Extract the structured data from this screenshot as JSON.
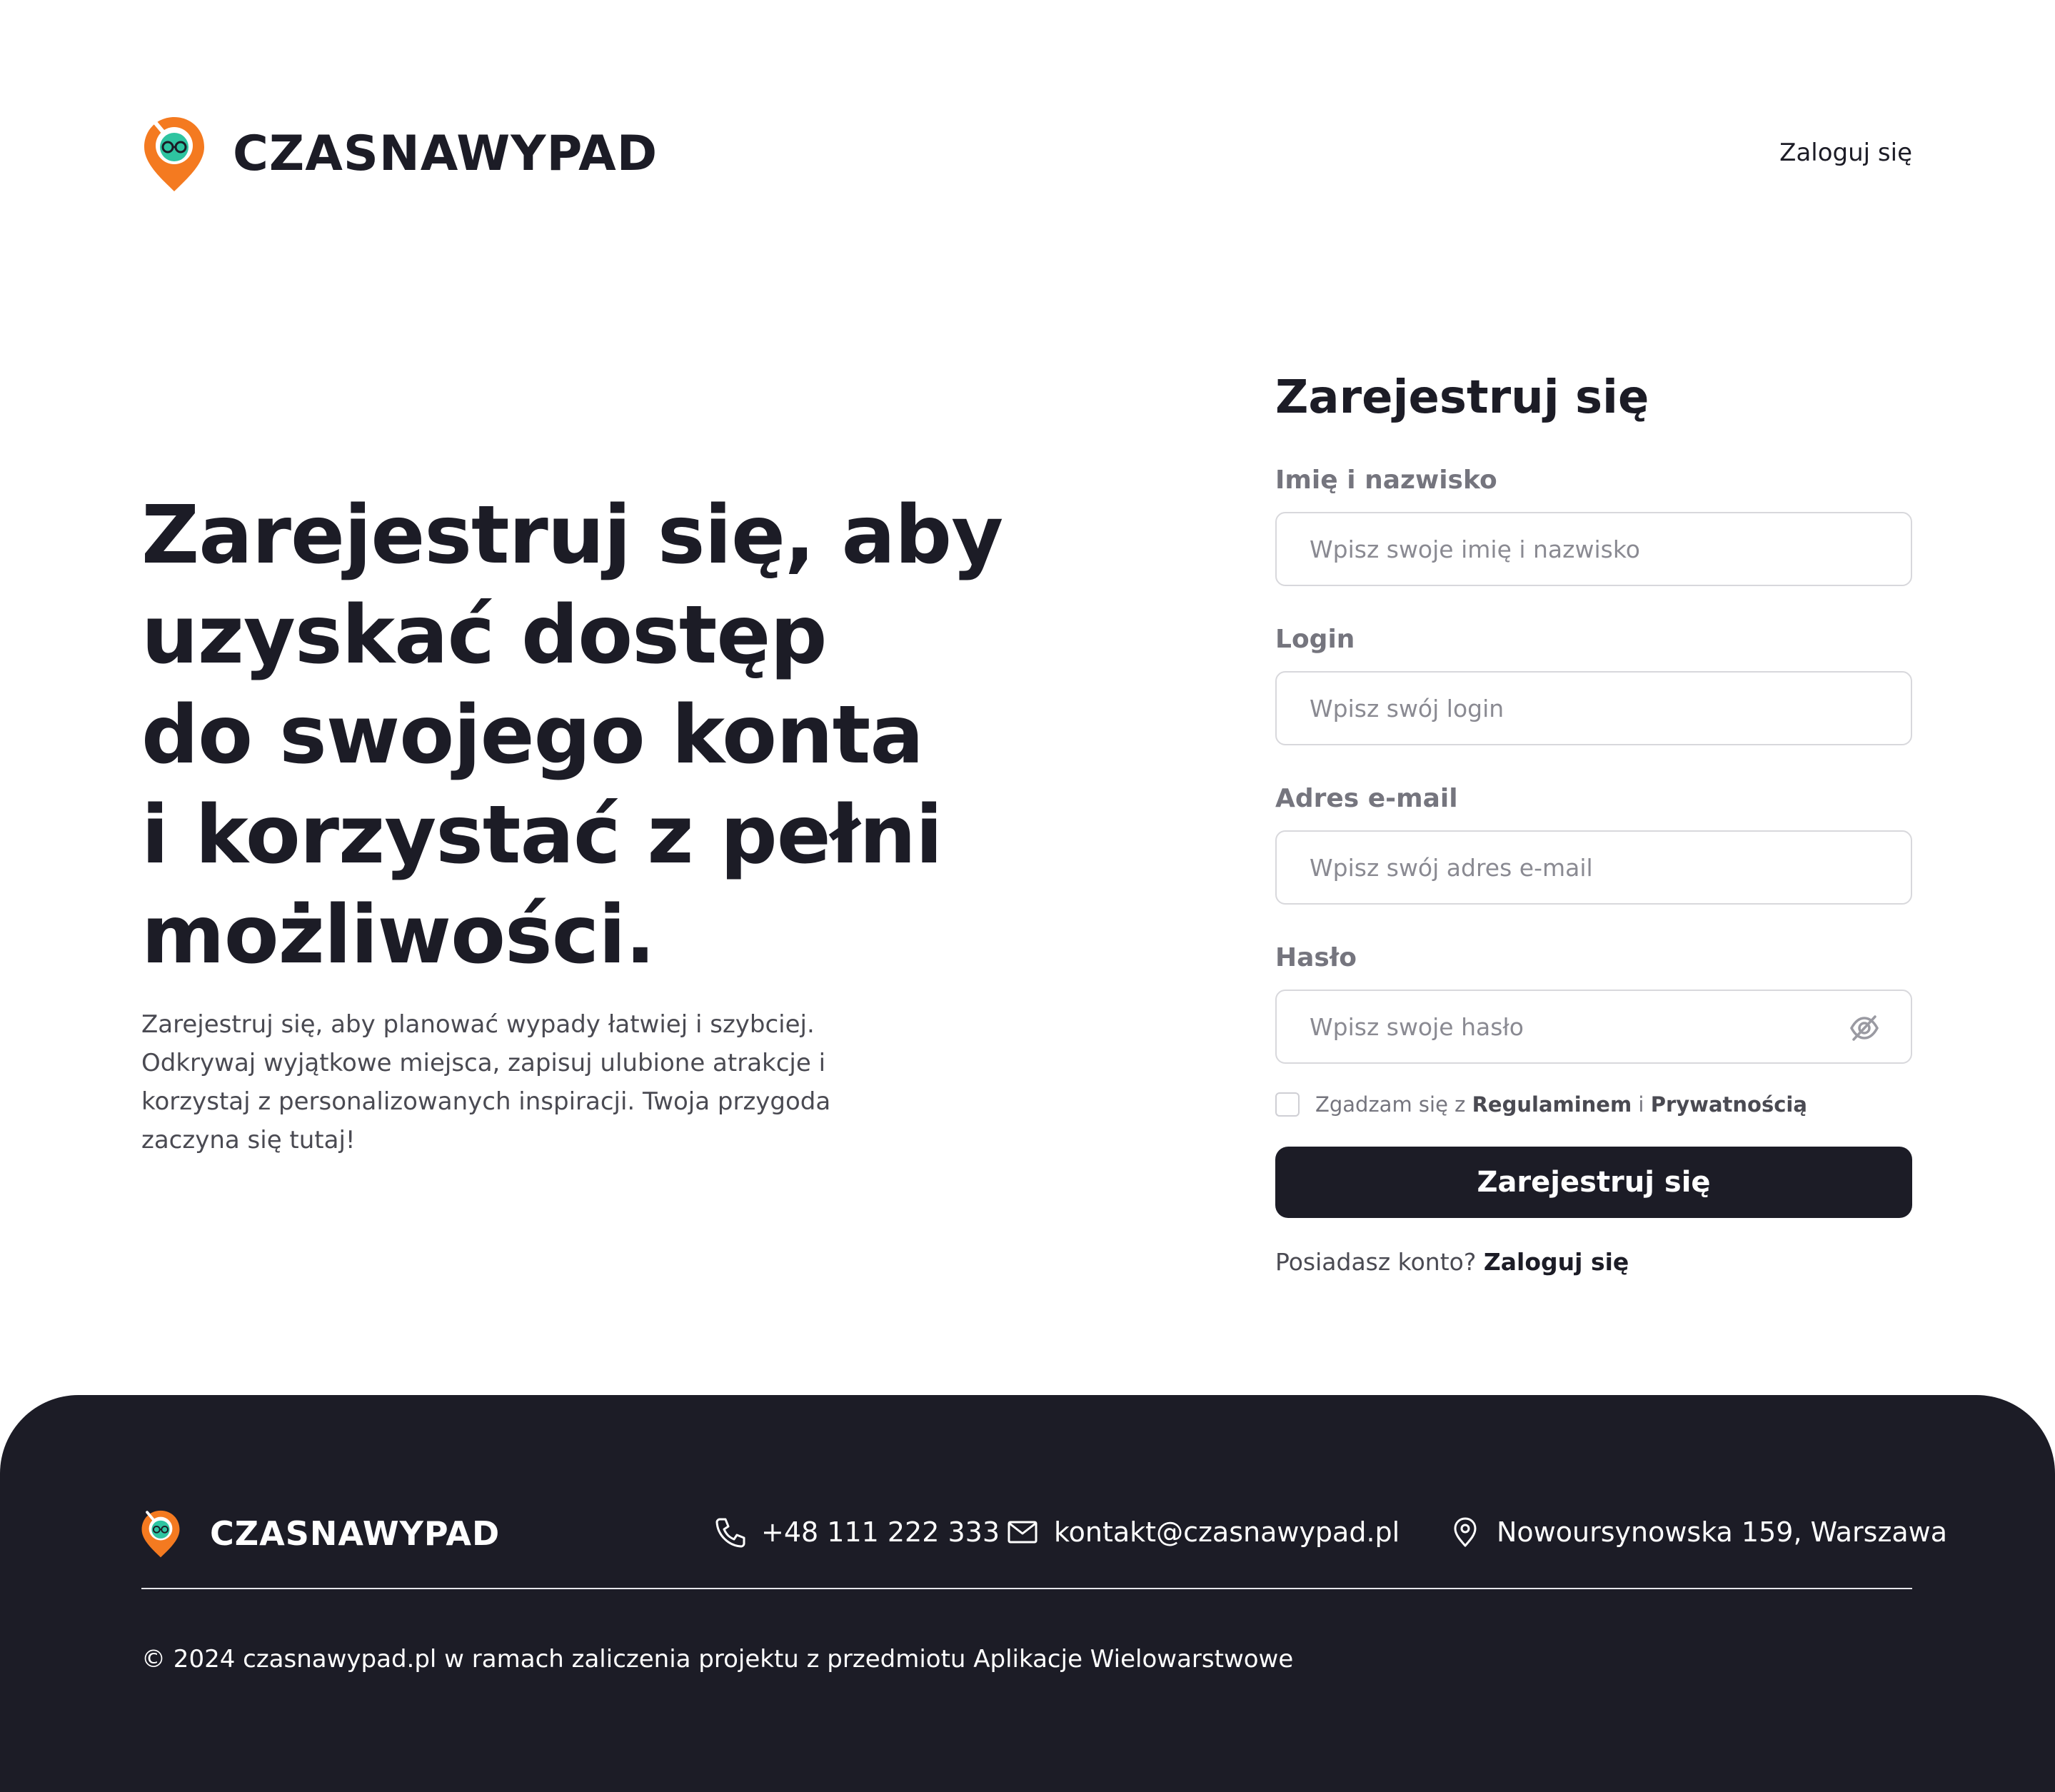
{
  "brand": {
    "name": "CZASNAWYPAD",
    "colors": {
      "pin_orange": "#F47A20",
      "pin_green": "#2EC4A0",
      "dark": "#1C1C26"
    }
  },
  "header": {
    "login_link": "Zaloguj się"
  },
  "hero": {
    "title_lines": [
      "Zarejestruj się, aby",
      "uzyskać dostęp",
      "do swojego konta",
      "i korzystać z pełni",
      "możliwości."
    ],
    "description": "Zarejestruj się, aby planować wypady łatwiej i szybciej. Odkrywaj wyjątkowe miejsca, zapisuj ulubione atrakcje i korzystaj z personalizowanych inspiracji. Twoja przygoda zaczyna się tutaj!"
  },
  "form": {
    "title": "Zarejestruj się",
    "fields": [
      {
        "label": "Imię i nazwisko",
        "placeholder": "Wpisz swoje imię i nazwisko",
        "value": ""
      },
      {
        "label": "Login",
        "placeholder": "Wpisz swój login",
        "value": ""
      },
      {
        "label": "Adres e-mail",
        "placeholder": "Wpisz swój adres e-mail",
        "value": ""
      },
      {
        "label": "Hasło",
        "placeholder": "Wpisz swoje hasło",
        "value": "",
        "icon": "eye-off-icon"
      }
    ],
    "agree": {
      "prefix": "Zgadzam się z",
      "terms": "Regulaminem",
      "and": "i",
      "privacy": "Prywatnością",
      "checked": false
    },
    "submit_label": "Zarejestruj się",
    "have_account_text": "Posiadasz konto?",
    "have_account_link": "Zaloguj się"
  },
  "footer": {
    "brand": "CZASNAWYPAD",
    "phone": "+48 111 222 333",
    "email": "kontakt@czasnawypad.pl",
    "address": "Nowoursynowska 159, Warszawa",
    "copyright": "© 2024 czasnawypad.pl w ramach zaliczenia projektu z przedmiotu Aplikacje Wielowarstwowe"
  }
}
